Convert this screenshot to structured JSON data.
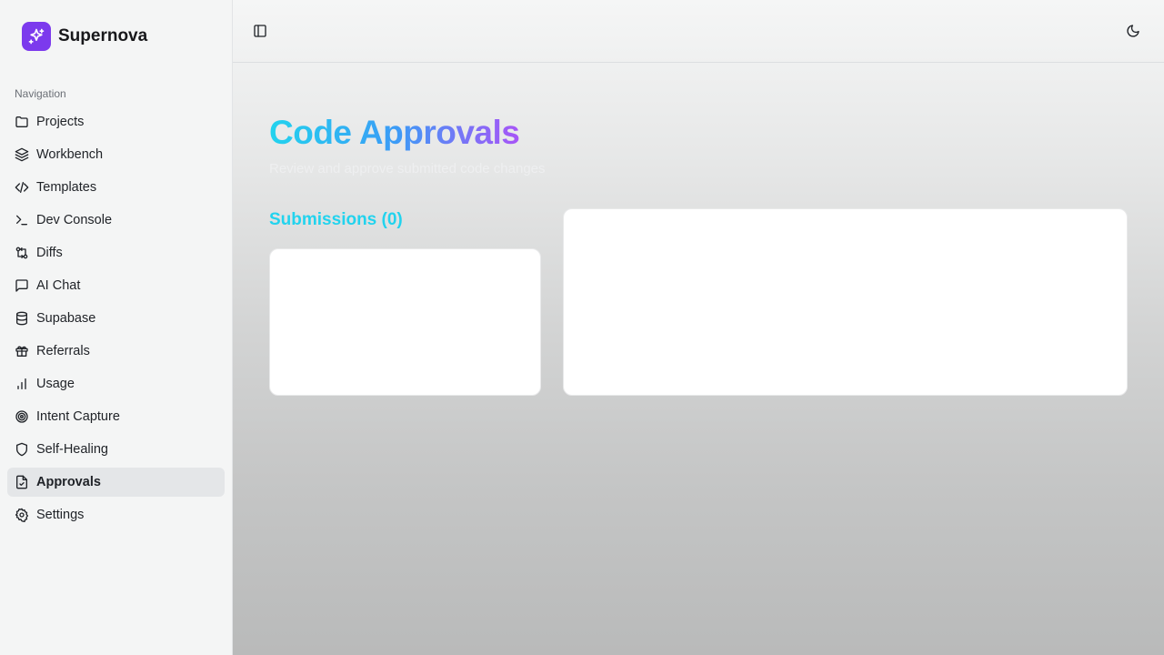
{
  "app": {
    "name": "Supernova"
  },
  "sidebar": {
    "heading": "Navigation",
    "items": [
      {
        "label": "Projects",
        "icon": "folder-icon"
      },
      {
        "label": "Workbench",
        "icon": "layers-icon"
      },
      {
        "label": "Templates",
        "icon": "code-icon"
      },
      {
        "label": "Dev Console",
        "icon": "terminal-icon"
      },
      {
        "label": "Diffs",
        "icon": "git-compare-icon"
      },
      {
        "label": "AI Chat",
        "icon": "message-square-icon"
      },
      {
        "label": "Supabase",
        "icon": "database-icon"
      },
      {
        "label": "Referrals",
        "icon": "gift-icon"
      },
      {
        "label": "Usage",
        "icon": "bar-chart-icon"
      },
      {
        "label": "Intent Capture",
        "icon": "target-icon"
      },
      {
        "label": "Self-Healing",
        "icon": "shield-icon"
      },
      {
        "label": "Approvals",
        "icon": "file-check-icon",
        "active": true
      },
      {
        "label": "Settings",
        "icon": "gear-icon"
      }
    ]
  },
  "page": {
    "title": "Code Approvals",
    "subtitle": "Review and approve submitted code changes",
    "submissions_heading": "Submissions (0)"
  },
  "colors": {
    "brand": "#7c3aed",
    "title_gradient": [
      "#22d3ee",
      "#3b9cf6",
      "#a855f7"
    ],
    "accent_cyan": "#22d3ee"
  }
}
